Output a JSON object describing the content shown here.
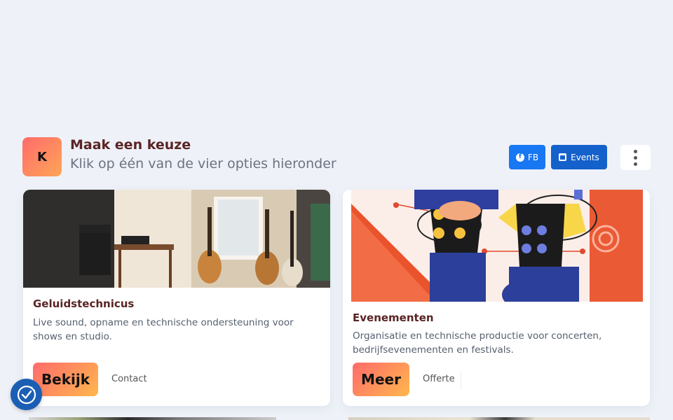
{
  "header": {
    "logo_letter": "K",
    "title": "Maak een keuze",
    "subtitle": "Klik op één van de vier opties hieronder",
    "fb_label": "FB",
    "events_label": "Events"
  },
  "cards": [
    {
      "title": "Geluidstechnicus",
      "description": "Live sound, opname en technische ondersteuning voor shows en studio.",
      "primary_label": "Bekijk",
      "secondary_label": "Contact"
    },
    {
      "title": "Evenementen",
      "description": "Organisatie en technische productie voor concerten, bedrijfsevenementen en festivals.",
      "primary_label": "Meer",
      "secondary_label": "Offerte"
    }
  ],
  "colors": {
    "accent_gradient_start": "#ff6b6b",
    "accent_gradient_end": "#ffb74d",
    "facebook_blue": "#1877f2",
    "events_blue": "#1461cc",
    "title_color": "#5a2424"
  },
  "icons": {
    "facebook": "facebook-icon",
    "calendar": "calendar-icon",
    "more": "more-vertical-icon",
    "cookie": "cookie-consent-icon"
  }
}
